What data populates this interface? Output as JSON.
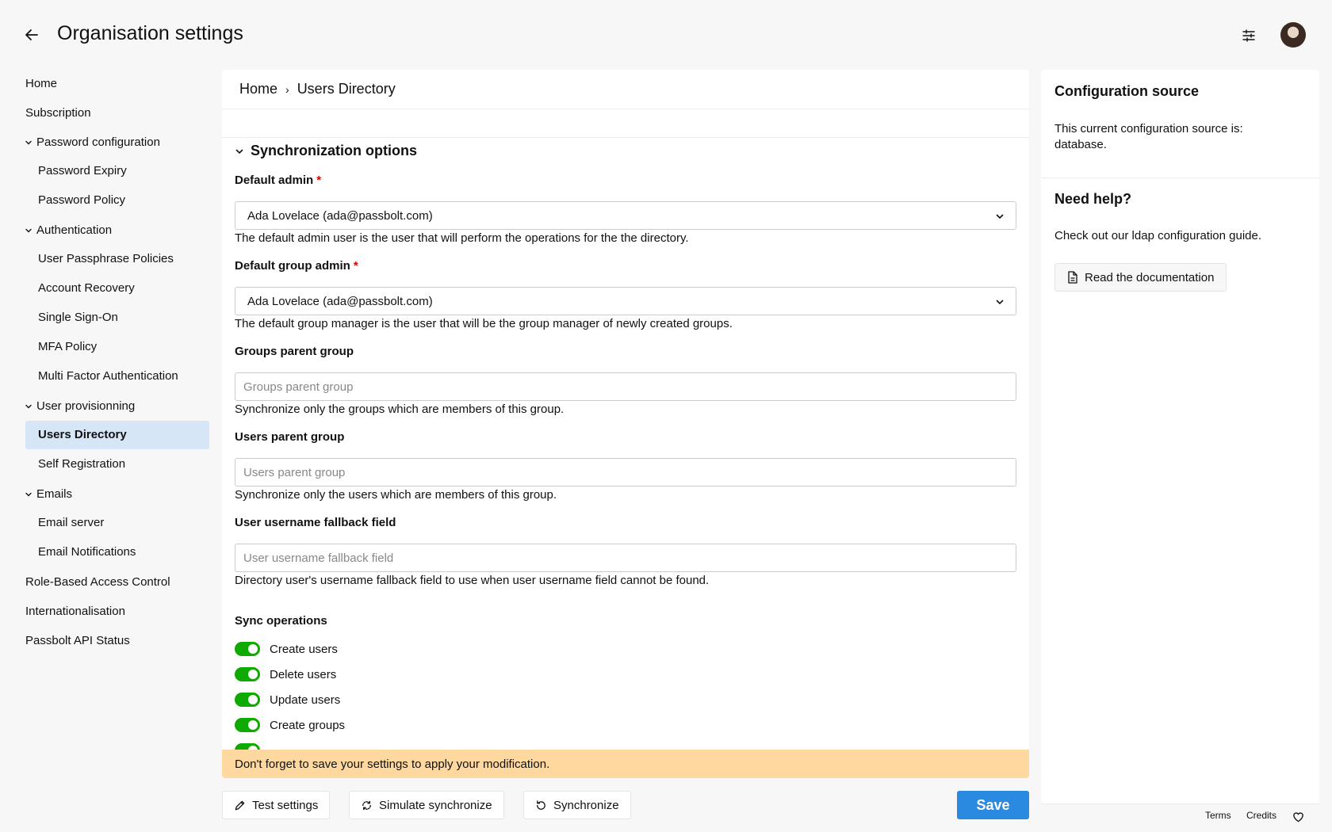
{
  "header": {
    "title": "Organisation settings"
  },
  "sidebar": {
    "items": [
      {
        "label": "Home"
      },
      {
        "label": "Subscription"
      },
      {
        "label": "Password configuration"
      },
      {
        "label": "Password Expiry"
      },
      {
        "label": "Password Policy"
      },
      {
        "label": "Authentication"
      },
      {
        "label": "User Passphrase Policies"
      },
      {
        "label": "Account Recovery"
      },
      {
        "label": "Single Sign-On"
      },
      {
        "label": "MFA Policy"
      },
      {
        "label": "Multi Factor Authentication"
      },
      {
        "label": "User provisionning"
      },
      {
        "label": "Users Directory"
      },
      {
        "label": "Self Registration"
      },
      {
        "label": "Emails"
      },
      {
        "label": "Email server"
      },
      {
        "label": "Email Notifications"
      },
      {
        "label": "Role-Based Access Control"
      },
      {
        "label": "Internationalisation"
      },
      {
        "label": "Passbolt API Status"
      }
    ]
  },
  "breadcrumb": {
    "home": "Home",
    "separator": "›",
    "current": "Users Directory"
  },
  "form": {
    "section_title": "Synchronization options",
    "default_admin_label": "Default admin",
    "required_mark": "*",
    "default_admin_value": "Ada Lovelace (ada@passbolt.com)",
    "default_admin_help": "The default admin user is the user that will perform the operations for the the directory.",
    "default_group_admin_label": "Default group admin",
    "default_group_admin_value": "Ada Lovelace (ada@passbolt.com)",
    "default_group_admin_help": "The default group manager is the user that will be the group manager of newly created groups.",
    "groups_parent_label": "Groups parent group",
    "groups_parent_placeholder": "Groups parent group",
    "groups_parent_help": "Synchronize only the groups which are members of this group.",
    "users_parent_label": "Users parent group",
    "users_parent_placeholder": "Users parent group",
    "users_parent_help": "Synchronize only the users which are members of this group.",
    "fallback_label": "User username fallback field",
    "fallback_placeholder": "User username fallback field",
    "fallback_help": "Directory user's username fallback field to use when user username field cannot be found.",
    "sync_ops_label": "Sync operations",
    "sync_ops": [
      {
        "label": "Create users"
      },
      {
        "label": "Delete users"
      },
      {
        "label": "Update users"
      },
      {
        "label": "Create groups"
      }
    ]
  },
  "warning": {
    "text": "Don't forget to save your settings to apply your modification."
  },
  "actions": {
    "test": "Test settings",
    "simulate": "Simulate synchronize",
    "synchronize": "Synchronize",
    "save": "Save"
  },
  "right_panel": {
    "config_title": "Configuration source",
    "config_text": "This current configuration source is: database.",
    "help_title": "Need help?",
    "help_text": "Check out our ldap configuration guide.",
    "doc_button": "Read the documentation"
  },
  "footer": {
    "terms": "Terms",
    "credits": "Credits"
  },
  "colors": {
    "accent": "#2a8ae0",
    "toggle_on": "#0eaa00",
    "warning_bg": "#fed89f",
    "active_nav_bg": "#d6e6f7",
    "required": "#d40101"
  }
}
